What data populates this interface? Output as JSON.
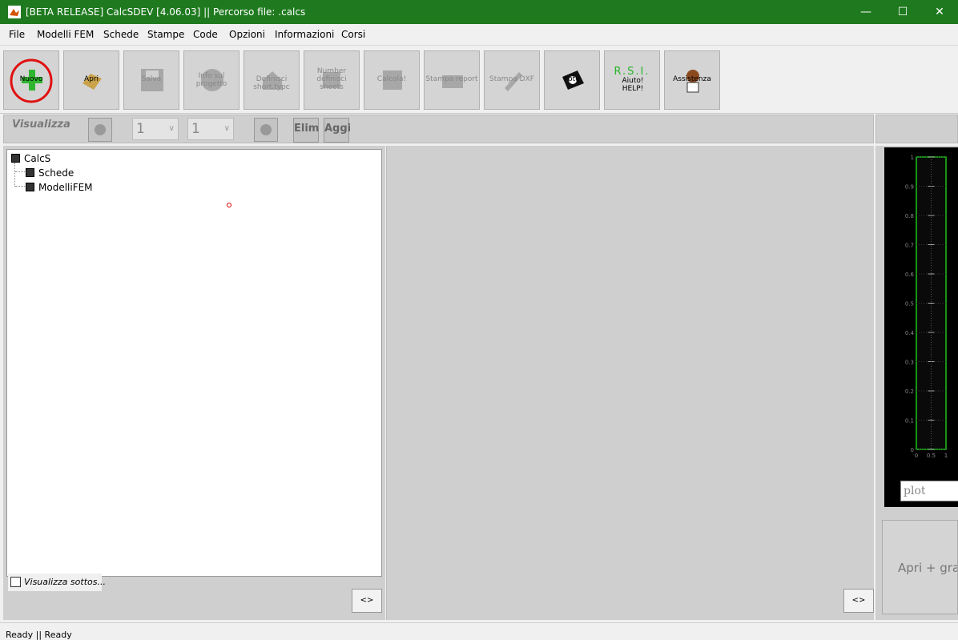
{
  "window": {
    "title": "[BETA RELEASE] CalcSDEV [4.06.03] || Percorso file: .calcs",
    "minimize": "—",
    "maximize": "☐",
    "close": "✕",
    "titlebar_color": "#1f7a1f"
  },
  "menu": [
    "File",
    "Modelli FEM",
    "Schede",
    "Stampe",
    "Code",
    "Opzioni",
    "Informazioni",
    "Corsi"
  ],
  "toolbar": [
    {
      "label": "Nuovo",
      "icon": "plus-icon",
      "enabled": true,
      "highlighted": true
    },
    {
      "label": "Apri",
      "icon": "folder-icon",
      "enabled": true
    },
    {
      "label": "Salva",
      "icon": "floppy-icon",
      "enabled": false
    },
    {
      "label": "Info sul progetto",
      "icon": "info-icon",
      "enabled": false
    },
    {
      "label": "Definisci short.typc",
      "icon": "home-icon",
      "enabled": false
    },
    {
      "label": "Number definisci sheets",
      "icon": "sheets-icon",
      "enabled": false
    },
    {
      "label": "Calcola!",
      "icon": "calculate-icon",
      "enabled": false
    },
    {
      "label": "Stampa report",
      "icon": "print-icon",
      "enabled": false
    },
    {
      "label": "Stampa DXF",
      "icon": "pencil-icon",
      "enabled": false
    },
    {
      "label": "Foto",
      "icon": "camera-icon",
      "enabled": true
    },
    {
      "label": "Aiuto! HELP!",
      "icon": "help-icon",
      "badge": "R.S.I.",
      "enabled": true
    },
    {
      "label": "Assistenza",
      "icon": "support-icon",
      "enabled": true
    }
  ],
  "controls": {
    "visualizza_label": "Visualizza",
    "combo1_value": "1",
    "combo2_value": "1",
    "elim_label": "Elim",
    "aggi_label": "Aggi"
  },
  "tree": {
    "root": "CalcS",
    "children": [
      "Schede",
      "ModelliFEM"
    ]
  },
  "checkbox_label": "Visualizza sottos...",
  "arrow_left": "<>",
  "arrow_mid": "<>",
  "plot": {
    "input_placeholder": "plot",
    "y_ticks": [
      "1",
      "0.9",
      "0.8",
      "0.7",
      "0.6",
      "0.5",
      "0.4",
      "0.3",
      "0.2",
      "0.1",
      "0"
    ],
    "x_ticks": [
      "0",
      "0.5",
      "1"
    ]
  },
  "open_graph_label": "Apri + grafico",
  "status": "Ready || Ready",
  "colors": {
    "accent": "#1f7a1f",
    "plot_border": "#1ac41a",
    "highlight_circle": "#e01010"
  }
}
